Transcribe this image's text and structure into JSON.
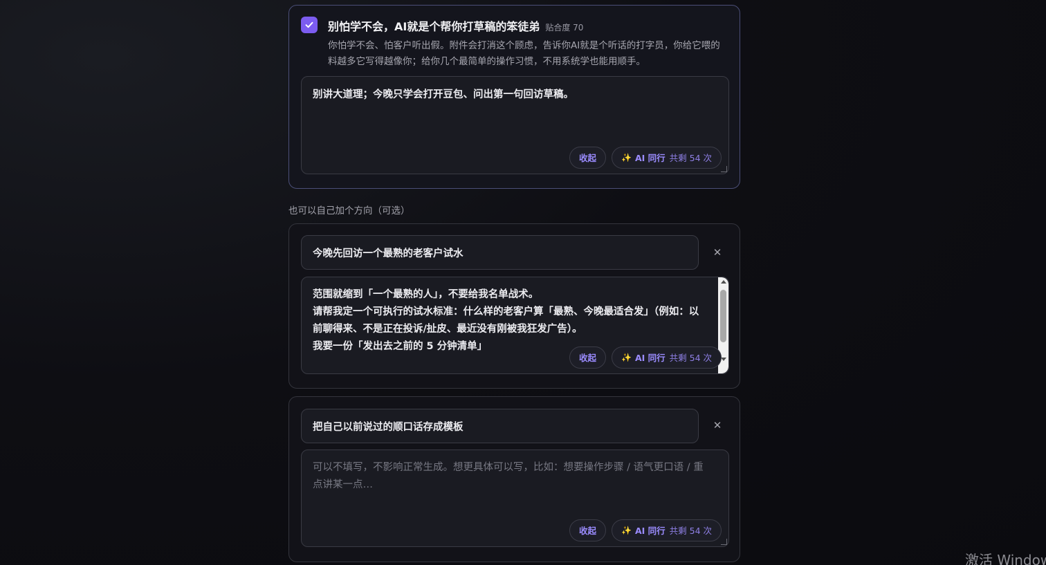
{
  "selected_card": {
    "title": "别怕学不会，AI就是个帮你打草稿的笨徒弟",
    "score": "贴合度 70",
    "description": "你怕学不会、怕客户听出假。附件会打消这个顾虑，告诉你AI就是个听话的打字员，你给它喂的料越多它写得越像你；给你几个最简单的操作习惯，不用系统学也能用顺手。",
    "textarea_value": "别讲大道理；今晚只学会打开豆包、问出第一句回访草稿。",
    "collapse_label": "收起",
    "ai_label": "AI 同行",
    "ai_count": "共剩 54 次",
    "accent": "#7c5cf0"
  },
  "custom_section": {
    "label": "也可以自己加个方向（可选）"
  },
  "directions": [
    {
      "title": "今晚先回访一个最熟的老客户试水",
      "textarea_lines": [
        "范围就缩到「一个最熟的人」，不要给我名单战术。",
        "请帮我定一个可执行的试水标准：什么样的老客户算「最熟、今晚最适合发」（例如：以前聊得来、不是正在投诉/扯皮、最近没有刚被我狂发广告）。",
        "我要一份「发出去之前的 5 分钟清单」"
      ],
      "collapse_label": "收起",
      "ai_label": "AI 同行",
      "ai_count": "共剩 54 次"
    },
    {
      "title": "把自己以前说过的顺口话存成模板",
      "textarea_placeholder": "可以不填写，不影响正常生成。想更具体可以写，比如：想要操作步骤 / 语气更口语 / 重点讲某一点…",
      "collapse_label": "收起",
      "ai_label": "AI 同行",
      "ai_count": "共剩 54 次"
    }
  ],
  "watermark": "激活 Windows"
}
